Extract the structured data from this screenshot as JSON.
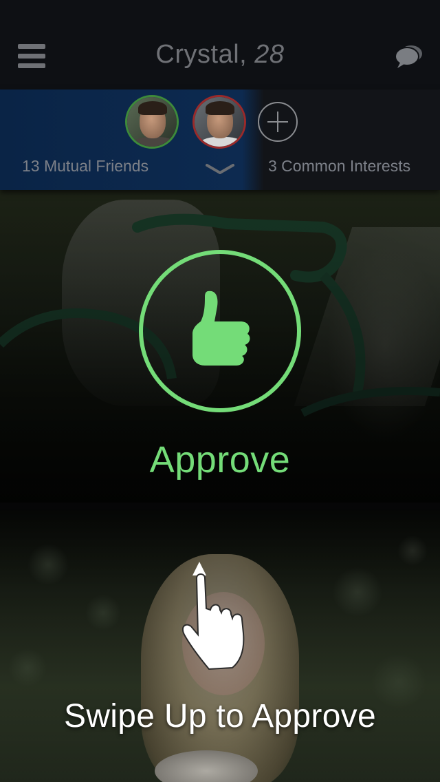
{
  "header": {
    "name": "Crystal,",
    "age": "28",
    "menu_icon": "hamburger-menu-icon",
    "chat_icon": "chat-bubbles-icon"
  },
  "social": {
    "mutual_friends_label": "13 Mutual Friends",
    "common_interests_label": "3 Common Interests",
    "expand_icon": "chevron-down-icon",
    "add_icon": "plus-circle-icon",
    "avatar_ring_colors": [
      "#3e8a3a",
      "#9a2a2a"
    ]
  },
  "approve": {
    "label": "Approve",
    "icon": "thumbs-up-icon",
    "color": "#74dc78"
  },
  "hint": {
    "label": "Swipe Up to Approve",
    "icon": "swipe-up-hand-icon"
  }
}
